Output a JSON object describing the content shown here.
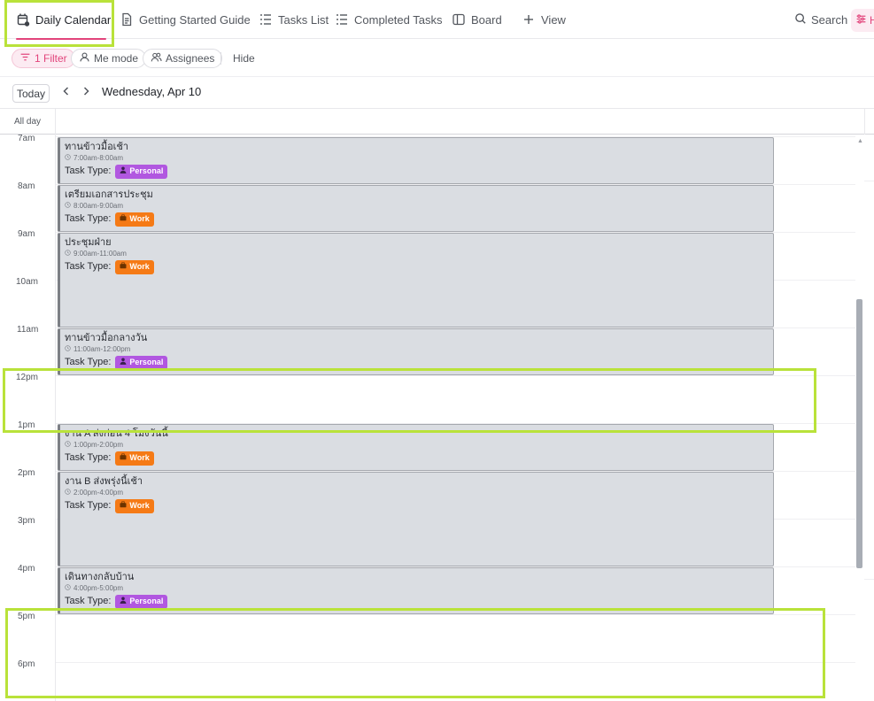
{
  "views": {
    "tabs": [
      {
        "label": "Daily Calendar",
        "icon": "calendar-icon"
      },
      {
        "label": "Getting Started Guide",
        "icon": "document-icon"
      },
      {
        "label": "Tasks List",
        "icon": "list-icon"
      },
      {
        "label": "Completed Tasks",
        "icon": "list-icon"
      },
      {
        "label": "Board",
        "icon": "board-icon"
      }
    ],
    "add_view_label": "View",
    "search_label": "Search",
    "more_label": "H"
  },
  "filters": {
    "filter_label": "1 Filter",
    "me_mode_label": "Me mode",
    "assignees_label": "Assignees",
    "hide_label": "Hide"
  },
  "date_nav": {
    "today_label": "Today",
    "date_title": "Wednesday, Apr 10"
  },
  "calendar": {
    "all_day_label": "All day",
    "hours": [
      "7am",
      "8am",
      "9am",
      "10am",
      "11am",
      "12pm",
      "1pm",
      "2pm",
      "3pm",
      "4pm",
      "5pm",
      "6pm"
    ],
    "task_type_label": "Task Type:",
    "events": [
      {
        "title": "ทานข้าวมื้อเช้า",
        "time": "7:00am-8:00am",
        "type": "Personal"
      },
      {
        "title": "เตรียมเอกสารประชุม",
        "time": "8:00am-9:00am",
        "type": "Work"
      },
      {
        "title": "ประชุมฝ่าย",
        "time": "9:00am-11:00am",
        "type": "Work"
      },
      {
        "title": "ทานข้าวมื้อกลางวัน",
        "time": "11:00am-12:00pm",
        "type": "Personal"
      },
      {
        "title": "งาน A ส่งก่อน 4 โมงวันนี้",
        "time": "1:00pm-2:00pm",
        "type": "Work"
      },
      {
        "title": "งาน B ส่งพรุ่งนี้เช้า",
        "time": "2:00pm-4:00pm",
        "type": "Work"
      },
      {
        "title": "เดินทางกลับบ้าน",
        "time": "4:00pm-5:00pm",
        "type": "Personal"
      }
    ]
  },
  "colors": {
    "accent": "#e2447b",
    "highlight": "#b9e23a",
    "personal": "#b157e0",
    "work": "#f57a16",
    "event_bg": "#dadde2"
  }
}
